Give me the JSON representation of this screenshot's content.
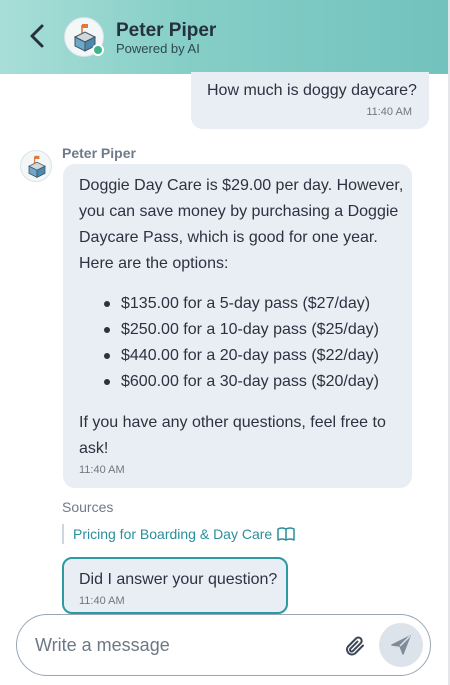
{
  "header": {
    "title": "Peter Piper",
    "subtitle": "Powered by AI",
    "back_icon": "chevron-left-icon",
    "avatar_icon": "mailbox-avatar-icon"
  },
  "messages": {
    "user": {
      "text": "How much is doggy daycare?",
      "time": "11:40 AM"
    },
    "bot": {
      "name": "Peter Piper",
      "intro": "Doggie Day Care is $29.00 per day. However, you can save money by purchasing a Doggie Daycare Pass, which is good for one year. Here are the options:",
      "bullets": [
        "$135.00 for a 5-day pass ($27/day)",
        "$250.00 for a 10-day pass ($25/day)",
        "$440.00 for a 20-day pass ($22/day)",
        "$600.00 for a 30-day pass ($20/day)"
      ],
      "outro": "If you have any other questions, feel free to ask!",
      "time": "11:40 AM"
    },
    "sources": {
      "label": "Sources",
      "link": "Pricing for Boarding & Day Care",
      "icon": "book-icon"
    },
    "followup": {
      "text": "Did I answer your question?",
      "time": "11:40 AM"
    }
  },
  "composer": {
    "placeholder": "Write a message",
    "attach_icon": "paperclip-icon",
    "send_icon": "send-icon"
  },
  "colors": {
    "header_start": "#a9ded8",
    "header_end": "#72c2bd",
    "bubble": "#e9edf4",
    "accent": "#2a9aa3",
    "link": "#2a8f9a"
  }
}
